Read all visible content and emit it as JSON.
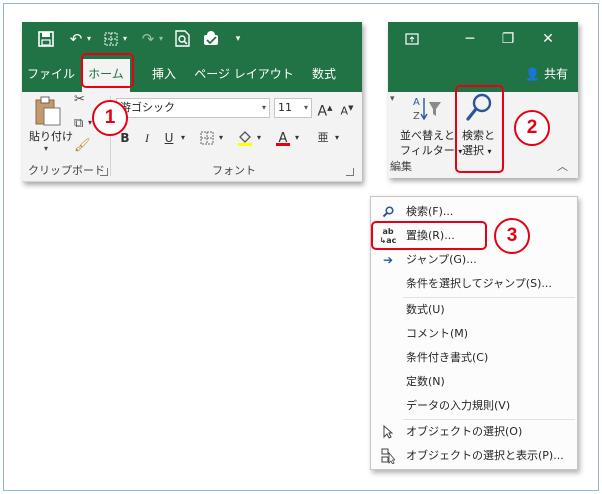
{
  "left_ribbon": {
    "tabs": [
      "ファイル",
      "ホーム",
      "挿入",
      "ページ レイアウト",
      "数式"
    ],
    "clipboard": {
      "paste_label": "貼り付け",
      "group_label": "クリップボード"
    },
    "font": {
      "font_name": "游ゴシック",
      "font_size": "11",
      "bold": "B",
      "italic": "I",
      "underline": "U",
      "grow_font": "A",
      "shrink_font": "A",
      "group_label": "フォント"
    }
  },
  "right_ribbon": {
    "share_label": "共有",
    "sort_filter_label_line1": "並べ替えと",
    "sort_filter_label_line2": "フィルター",
    "find_select_label_line1": "検索と",
    "find_select_label_line2": "選択",
    "group_label": "編集"
  },
  "menu": {
    "items": [
      {
        "label": "検索(F)...",
        "icon": "search-icon"
      },
      {
        "label": "置換(R)...",
        "icon": "replace-icon"
      },
      {
        "label": "ジャンプ(G)...",
        "icon": "arrow-right-icon"
      },
      {
        "label": "条件を選択してジャンプ(S)...",
        "icon": ""
      },
      {
        "label": "数式(U)",
        "icon": ""
      },
      {
        "label": "コメント(M)",
        "icon": ""
      },
      {
        "label": "条件付き書式(C)",
        "icon": ""
      },
      {
        "label": "定数(N)",
        "icon": ""
      },
      {
        "label": "データの入力規則(V)",
        "icon": ""
      },
      {
        "label": "オブジェクトの選択(O)",
        "icon": "cursor-icon"
      },
      {
        "label": "オブジェクトの選択と表示(P)...",
        "icon": "selection-pane-icon"
      }
    ]
  },
  "annotations": {
    "step1": "1",
    "step2": "2",
    "step3": "3"
  },
  "colors": {
    "excel_green": "#217346",
    "annotation_red": "#e60012",
    "ribbon_bg": "#f3f3f3"
  }
}
